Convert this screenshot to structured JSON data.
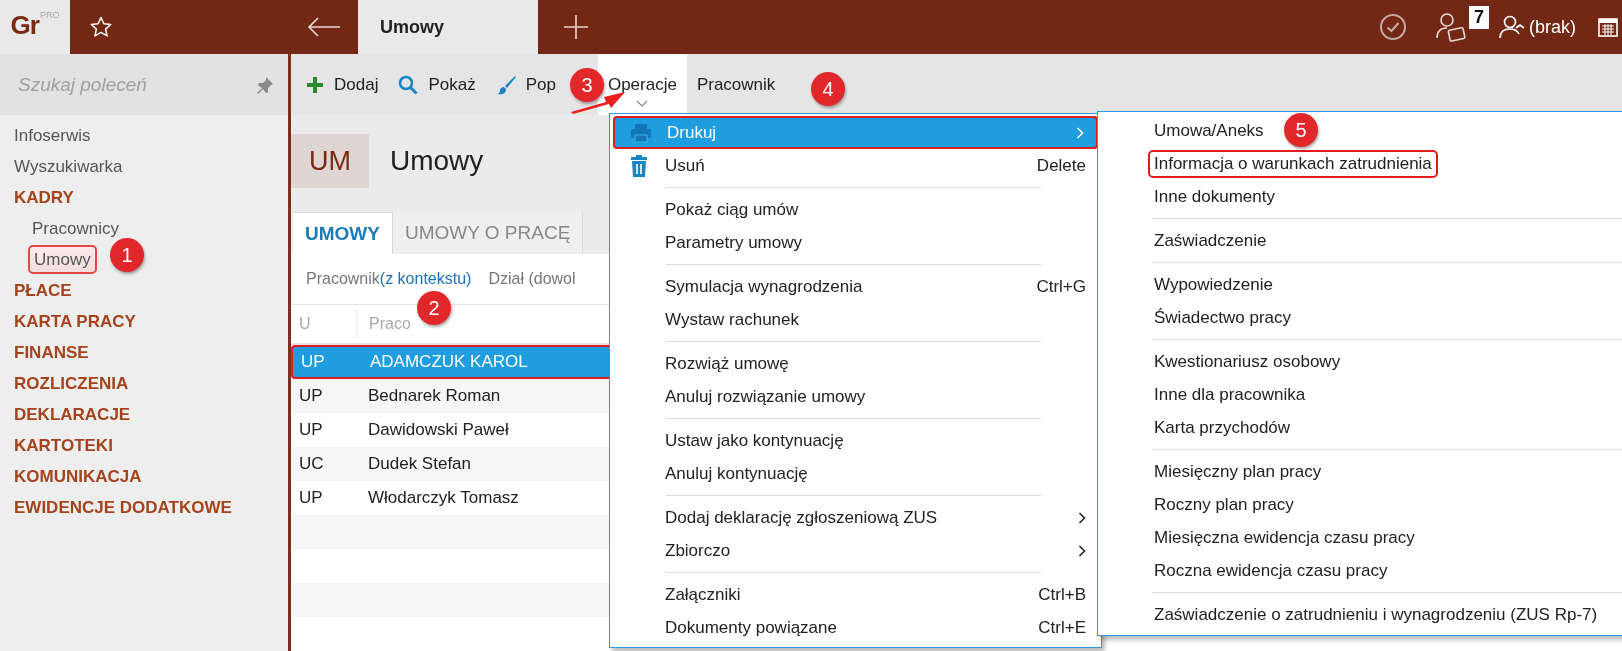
{
  "app": {
    "logo": "Gr",
    "logo_badge": "PRO",
    "tab_title": "Umowy",
    "badge_count": "7",
    "user": "(brak)"
  },
  "sidebar": {
    "search_placeholder": "Szukaj poleceń",
    "items": [
      {
        "label": "Infoserwis",
        "kind": "link"
      },
      {
        "label": "Wyszukiwarka",
        "kind": "link"
      },
      {
        "label": "KADRY",
        "kind": "section",
        "children": [
          {
            "label": "Pracownicy",
            "selected": false
          },
          {
            "label": "Umowy",
            "selected": true
          }
        ]
      },
      {
        "label": "PŁACE",
        "kind": "section"
      },
      {
        "label": "KARTA PRACY",
        "kind": "section"
      },
      {
        "label": "FINANSE",
        "kind": "section"
      },
      {
        "label": "ROZLICZENIA",
        "kind": "section"
      },
      {
        "label": "DEKLARACJE",
        "kind": "section"
      },
      {
        "label": "KARTOTEKI",
        "kind": "section"
      },
      {
        "label": "KOMUNIKACJA",
        "kind": "section"
      },
      {
        "label": "EWIDENCJE DODATKOWE",
        "kind": "section"
      }
    ]
  },
  "toolbar": [
    {
      "label": "Dodaj",
      "kind": "add",
      "selected": false
    },
    {
      "label": "Pokaż",
      "kind": "view",
      "selected": false
    },
    {
      "label": "Pop",
      "kind": "edit",
      "selected": false
    },
    {
      "label": "Operacje",
      "kind": "dropdown",
      "selected": true
    },
    {
      "label": "Pracownik",
      "kind": "dropdown",
      "selected": false
    }
  ],
  "header": {
    "code": "UM",
    "title": "Umowy"
  },
  "tabs": [
    {
      "label": "UMOWY",
      "selected": true
    },
    {
      "label": "UMOWY O PRACĘ",
      "selected": false
    }
  ],
  "filters": [
    {
      "label": "Pracownik",
      "link": "(z kontekstu)"
    },
    {
      "label": "Dział (dowol"
    }
  ],
  "table": {
    "columns": [
      "U",
      "Praco"
    ],
    "rows": [
      {
        "cells": [
          "UP",
          "ADAMCZUK KAROL"
        ],
        "selected": true,
        "outlined": true
      },
      {
        "cells": [
          "UP",
          "Bednarek Roman"
        ],
        "selected": false,
        "outlined": false
      },
      {
        "cells": [
          "UP",
          "Dawidowski Paweł"
        ],
        "selected": false,
        "outlined": false
      },
      {
        "cells": [
          "UC",
          "Dudek Stefan"
        ],
        "selected": false,
        "outlined": false
      },
      {
        "cells": [
          "UP",
          "Włodarczyk Tomasz"
        ],
        "selected": false,
        "outlined": false
      }
    ]
  },
  "menu": {
    "groups": [
      [
        {
          "label": "Drukuj",
          "kind": "print",
          "submenu": true,
          "selected": true,
          "outlined": true
        },
        {
          "label": "Usuń",
          "kind": "delete",
          "shortcut": "Delete",
          "submenu": false,
          "selected": false,
          "outlined": false
        }
      ],
      [
        {
          "label": "Pokaż ciąg umów",
          "kind": "text",
          "submenu": false,
          "selected": false,
          "outlined": false
        },
        {
          "label": "Parametry umowy",
          "kind": "text",
          "submenu": false,
          "selected": false,
          "outlined": false
        }
      ],
      [
        {
          "label": "Symulacja wynagrodzenia",
          "kind": "text",
          "shortcut": "Ctrl+G",
          "submenu": false,
          "selected": false,
          "outlined": false
        },
        {
          "label": "Wystaw rachunek",
          "kind": "text",
          "submenu": false,
          "selected": false,
          "outlined": false
        }
      ],
      [
        {
          "label": "Rozwiąż umowę",
          "kind": "text",
          "submenu": false,
          "selected": false,
          "outlined": false
        },
        {
          "label": "Anuluj rozwiązanie umowy",
          "kind": "text",
          "submenu": false,
          "selected": false,
          "outlined": false
        }
      ],
      [
        {
          "label": "Ustaw jako kontynuację",
          "kind": "text",
          "submenu": false,
          "selected": false,
          "outlined": false
        },
        {
          "label": "Anuluj kontynuację",
          "kind": "text",
          "submenu": false,
          "selected": false,
          "outlined": false
        }
      ],
      [
        {
          "label": "Dodaj deklarację zgłoszeniową ZUS",
          "kind": "text",
          "submenu": true,
          "selected": false,
          "outlined": false
        },
        {
          "label": "Zbiorczo",
          "kind": "text",
          "submenu": true,
          "selected": false,
          "outlined": false
        }
      ],
      [
        {
          "label": "Załączniki",
          "kind": "text",
          "shortcut": "Ctrl+B",
          "submenu": false,
          "selected": false,
          "outlined": false
        },
        {
          "label": "Dokumenty powiązane",
          "kind": "text",
          "shortcut": "Ctrl+E",
          "submenu": false,
          "selected": false,
          "outlined": false
        }
      ]
    ]
  },
  "submenu": {
    "groups": [
      [
        {
          "label": "Umowa/Aneks",
          "outlined": false
        },
        {
          "label": "Informacja o warunkach zatrudnienia",
          "outlined": true
        },
        {
          "label": "Inne dokumenty",
          "outlined": false
        }
      ],
      [
        {
          "label": "Zaświadczenie",
          "outlined": false
        }
      ],
      [
        {
          "label": "Wypowiedzenie",
          "outlined": false
        },
        {
          "label": "Świadectwo pracy",
          "outlined": false
        }
      ],
      [
        {
          "label": "Kwestionariusz osobowy",
          "outlined": false
        },
        {
          "label": "Inne dla pracownika",
          "outlined": false
        },
        {
          "label": "Karta przychodów",
          "outlined": false
        }
      ],
      [
        {
          "label": "Miesięczny plan pracy",
          "outlined": false
        },
        {
          "label": "Roczny plan pracy",
          "outlined": false
        },
        {
          "label": "Miesięczna ewidencja czasu pracy",
          "outlined": false
        },
        {
          "label": "Roczna ewidencja czasu pracy",
          "outlined": false
        }
      ],
      [
        {
          "label": "Zaświadczenie o zatrudnieniu i wynagrodzeniu (ZUS Rp-7)",
          "outlined": false
        }
      ]
    ]
  },
  "callouts": [
    "1",
    "2",
    "3",
    "4",
    "5"
  ]
}
